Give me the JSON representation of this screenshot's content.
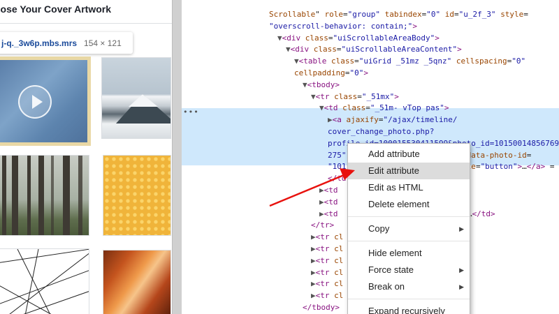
{
  "left_panel": {
    "title": "oose Your Cover Artwork",
    "tooltip": {
      "filename": "j-q._3w6p.mbs.mrs",
      "dimensions": "154 × 121"
    },
    "tiles": [
      "video-thumbnail",
      "snowy-mountain",
      "foggy-forest",
      "honey-pattern",
      "line-art",
      "red-canyon"
    ]
  },
  "devtools": {
    "lines": [
      {
        "indent": 0,
        "html": "<span class='attr'>Scrollable</span>\" <span class='attr'>role</span>=<span class='val'>\"group\"</span> <span class='attr'>tabindex</span>=<span class='val'>\"0\"</span> <span class='attr'>id</span>=<span class='val'>\"u_2f_3\"</span> <span class='attr'>style</span>="
      },
      {
        "indent": 0,
        "html": "<span class='val'>\"overscroll-behavior: contain;\"</span><span class='tag'>&gt;</span>"
      },
      {
        "indent": 1,
        "html": "<span class='tri'>▼</span><span class='tag'>&lt;div</span> <span class='attr'>class</span>=<span class='val'>\"uiScrollableAreaBody\"</span><span class='tag'>&gt;</span>"
      },
      {
        "indent": 2,
        "html": "<span class='tri'>▼</span><span class='tag'>&lt;div</span> <span class='attr'>class</span>=<span class='val'>\"uiScrollableAreaContent\"</span><span class='tag'>&gt;</span>"
      },
      {
        "indent": 3,
        "html": "<span class='tri'>▼</span><span class='tag'>&lt;table</span> <span class='attr'>class</span>=<span class='val'>\"uiGrid _51mz _5qnz\"</span> <span class='attr'>cellspacing</span>=<span class='val'>\"0\"</span>"
      },
      {
        "indent": 3,
        "html": "<span class='attr'>cellpadding</span>=<span class='val'>\"0\"</span><span class='tag'>&gt;</span>"
      },
      {
        "indent": 4,
        "html": "<span class='tri'>▼</span><span class='tag'>&lt;tbody&gt;</span>"
      },
      {
        "indent": 5,
        "html": "<span class='tri'>▼</span><span class='tag'>&lt;tr</span> <span class='attr'>class</span>=<span class='val'>\"_51mx\"</span><span class='tag'>&gt;</span>"
      },
      {
        "indent": 6,
        "html": "<span class='tri'>▼</span><span class='tag'>&lt;td</span> <span class='attr'>class</span>=<span class='val'>\"_51m- vTop pas\"</span><span class='tag'>&gt;</span>"
      },
      {
        "indent": 7,
        "html": "<span class='tri'>▶</span><span class='tag'>&lt;a</span> <span class='attr'>ajaxify</span>=<span class='val'>\"/ajax/timeline/</span>"
      },
      {
        "indent": 7,
        "html": "<span class='val'>cover_change_photo.php?</span>"
      },
      {
        "indent": 7,
        "html": "<span class='val'>profile_id=100015530411599&amp;photo_id=10150014856769</span>"
      },
      {
        "indent": 7,
        "html": "<span class='val'>275\"</span>                          <span class='attr'>data-photo-id</span>="
      },
      {
        "indent": 7,
        "html": "<span class='val'>\"101</span>                          <span class='attr'>le</span>=<span class='val'>\"button\"</span><span class='tag'>&gt;</span>…<span class='tag'>&lt;/a&gt;</span> = $0"
      },
      {
        "indent": 7,
        "html": "<span class='tag'>&lt;/td</span>"
      },
      {
        "indent": 6,
        "html": "<span class='tri'>▶</span><span class='tag'>&lt;td</span>                          <span class='tag'>d&gt;</span>"
      },
      {
        "indent": 6,
        "html": "<span class='tri'>▶</span><span class='tag'>&lt;td</span>                          <span class='tag'>d&gt;</span>"
      },
      {
        "indent": 6,
        "html": "<span class='tri'>▶</span><span class='tag'>&lt;td</span>                          <span class='tag'>\"&gt;</span>…<span class='tag'>&lt;/td&gt;</span>"
      },
      {
        "indent": 5,
        "html": "<span class='tag'>&lt;/tr&gt;</span>"
      },
      {
        "indent": 5,
        "html": "<span class='tri'>▶</span><span class='tag'>&lt;tr</span> <span class='attr'>cl</span>"
      },
      {
        "indent": 5,
        "html": "<span class='tri'>▶</span><span class='tag'>&lt;tr</span> <span class='attr'>cl</span>"
      },
      {
        "indent": 5,
        "html": "<span class='tri'>▶</span><span class='tag'>&lt;tr</span> <span class='attr'>cl</span>"
      },
      {
        "indent": 5,
        "html": "<span class='tri'>▶</span><span class='tag'>&lt;tr</span> <span class='attr'>cl</span>"
      },
      {
        "indent": 5,
        "html": "<span class='tri'>▶</span><span class='tag'>&lt;tr</span> <span class='attr'>cl</span>"
      },
      {
        "indent": 5,
        "html": "<span class='tri'>▶</span><span class='tag'>&lt;tr</span> <span class='attr'>cl</span>"
      },
      {
        "indent": 4,
        "html": "<span class='tag'>&lt;/tbody&gt;</span>"
      },
      {
        "indent": 3,
        "html": "<span class='tag'>&lt;/table&gt;</span>"
      }
    ]
  },
  "context_menu": {
    "items": [
      {
        "label": "Add attribute",
        "has_submenu": false,
        "hover": false
      },
      {
        "label": "Edit attribute",
        "has_submenu": false,
        "hover": true
      },
      {
        "label": "Edit as HTML",
        "has_submenu": false,
        "hover": false
      },
      {
        "label": "Delete element",
        "has_submenu": false,
        "hover": false
      },
      {
        "separator": true
      },
      {
        "label": "Copy",
        "has_submenu": true,
        "hover": false
      },
      {
        "separator": true
      },
      {
        "label": "Hide element",
        "has_submenu": false,
        "hover": false
      },
      {
        "label": "Force state",
        "has_submenu": true,
        "hover": false
      },
      {
        "label": "Break on",
        "has_submenu": true,
        "hover": false
      },
      {
        "separator": true
      },
      {
        "label": "Expand recursively",
        "has_submenu": false,
        "hover": false
      }
    ]
  },
  "annotation": {
    "arrow_color": "#e8120e"
  }
}
